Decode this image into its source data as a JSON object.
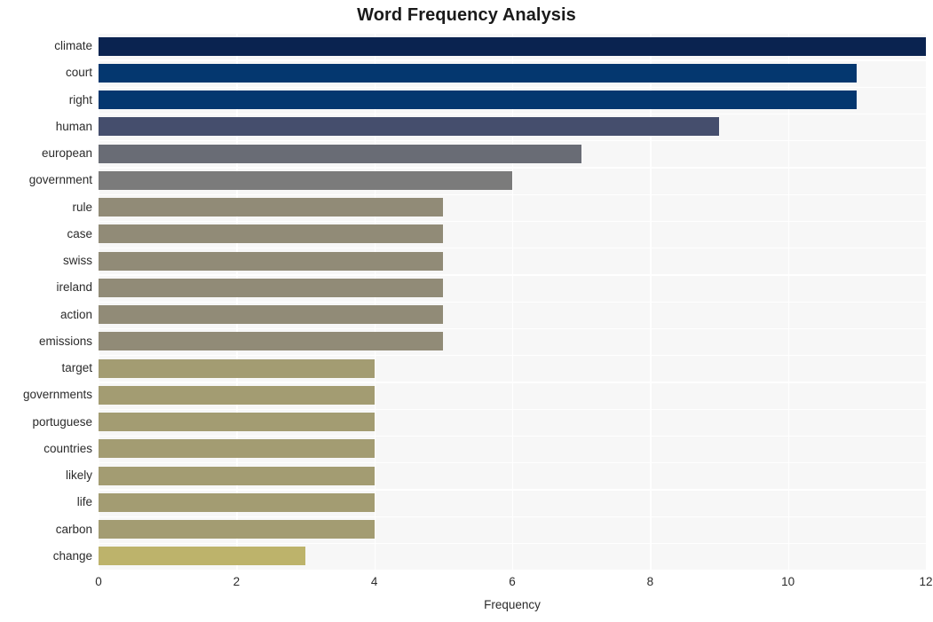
{
  "chart_data": {
    "type": "bar",
    "orientation": "horizontal",
    "title": "Word Frequency Analysis",
    "xlabel": "Frequency",
    "ylabel": "",
    "xlim": [
      0,
      12
    ],
    "xticks": [
      0,
      2,
      4,
      6,
      8,
      10,
      12
    ],
    "xtick_labels": [
      "0",
      "2",
      "4",
      "6",
      "8",
      "10",
      "12"
    ],
    "grid": true,
    "legend": false,
    "categories": [
      "climate",
      "court",
      "right",
      "human",
      "european",
      "government",
      "rule",
      "case",
      "swiss",
      "ireland",
      "action",
      "emissions",
      "target",
      "governments",
      "portuguese",
      "countries",
      "likely",
      "life",
      "carbon",
      "change"
    ],
    "values": [
      12,
      11,
      11,
      9,
      7,
      6,
      5,
      5,
      5,
      5,
      5,
      5,
      4,
      4,
      4,
      4,
      4,
      4,
      4,
      3
    ],
    "bar_colors": [
      "#0a2350",
      "#04376f",
      "#04376f",
      "#454e6d",
      "#696c75",
      "#7b7b7b",
      "#918b77",
      "#918b77",
      "#918b77",
      "#918b77",
      "#918b77",
      "#918b77",
      "#a39c72",
      "#a39c72",
      "#a39c72",
      "#a39c72",
      "#a39c72",
      "#a39c72",
      "#a39c72",
      "#bdb36b"
    ]
  },
  "style": {
    "figure_background": "#ffffff",
    "plot_background": "#f7f7f7",
    "grid_color": "#ffffff",
    "text_color": "#2b2b2b",
    "title_color": "#1a1a1a"
  }
}
